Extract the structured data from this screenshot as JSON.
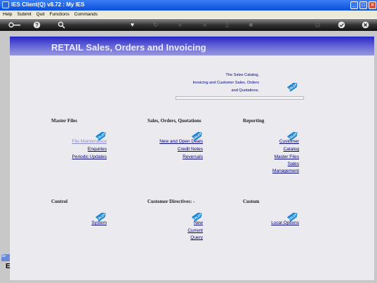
{
  "window": {
    "title": "IES Client(Q) v8.72 : My IES"
  },
  "menu": [
    "Help",
    "Submit",
    "Quit",
    "Functions",
    "Commands"
  ],
  "toolbar": {
    "icons": [
      "key-icon",
      "help-icon",
      "search-icon",
      "heart-icon",
      "refresh-icon",
      "rewind-icon",
      "fast-forward-icon",
      "page-icon",
      "stop-icon",
      "print-icon",
      "ok-icon",
      "close-icon"
    ]
  },
  "page": {
    "heading": "RETAIL Sales, Orders and Invoicing",
    "description": [
      "The Sales Catalog,",
      "Invoicing and Customer Sales, Orders",
      "and Quotations."
    ]
  },
  "sections": {
    "master_files": {
      "title": "Master Files",
      "links": [
        "File Maintenance",
        "Enquiries",
        "Periodic Updates"
      ]
    },
    "sales": {
      "title": "Sales, Orders, Quotations",
      "links": [
        "New and Open Deals",
        "Credit Notes",
        "Reversals"
      ]
    },
    "reporting": {
      "title": "Reporting",
      "links": [
        "Customer",
        "Catalog",
        "Master Files",
        "Sales",
        "Management"
      ]
    },
    "control": {
      "title": "Control",
      "links": [
        "System"
      ]
    },
    "directives": {
      "title": "Customer Directives: -",
      "links": [
        "New",
        "Current",
        "Query"
      ]
    },
    "custom": {
      "title": "Custom",
      "links": [
        "Local Options"
      ]
    }
  },
  "side_strip": {
    "tab": "Se",
    "letter": "E"
  },
  "colors": {
    "banner": "#2626c8",
    "link": "#00007a",
    "tag": "#1e88d8"
  }
}
